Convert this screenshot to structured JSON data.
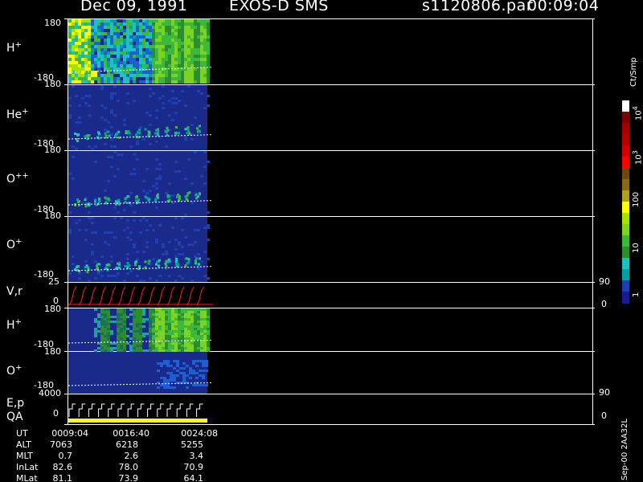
{
  "header": {
    "date": "Dec 09, 1991",
    "instrument": "EXOS-D SMS",
    "file": "s1120806.par",
    "time": "00:09:04"
  },
  "colorbar": {
    "unit": "Ct/Smp",
    "tick_labels": [
      "10",
      "10",
      "10",
      "100",
      "10",
      "1"
    ],
    "exponents": [
      "4",
      "3"
    ]
  },
  "side_note": "Sep-00 2AA32L",
  "chart_data": {
    "type": "heatmap",
    "panels": [
      {
        "name": "H+",
        "ylim": [
          -180,
          180
        ],
        "ytick_top": "180",
        "ytick_bottom": "-180"
      },
      {
        "name": "He+",
        "ylim": [
          -180,
          180
        ],
        "ytick_top": "180",
        "ytick_bottom": "-180"
      },
      {
        "name": "O++",
        "ylim": [
          -180,
          180
        ],
        "ytick_top": "180",
        "ytick_bottom": "-180"
      },
      {
        "name": "O+",
        "ylim": [
          -180,
          180
        ],
        "ytick_top": "180",
        "ytick_bottom": "-180"
      },
      {
        "name": "V,r",
        "ytick_top": "25",
        "ytick_bottom": "0",
        "rtick_top": "90",
        "rtick_bottom": "0"
      },
      {
        "name": "H+",
        "ylim": [
          -180,
          180
        ],
        "ytick_top": "180",
        "ytick_bottom": "-180"
      },
      {
        "name": "O+",
        "ylim": [
          -180,
          180
        ],
        "ytick_top": "180",
        "ytick_bottom": "-180"
      },
      {
        "name": "E,p",
        "name2": "QA",
        "ytick_top": "4000",
        "ytick_bottom": "0",
        "rtick_top": "90",
        "rtick_bottom": "0"
      }
    ],
    "x_labels": {
      "UT": [
        "0009:04",
        "0016:40",
        "0024:08"
      ],
      "ALT": [
        "7063",
        "6218",
        "5255"
      ],
      "MLT": [
        "0.7",
        "2.6",
        "3.4"
      ],
      "InLat": [
        "82.6",
        "78.0",
        "70.9"
      ],
      "MLat": [
        "81.1",
        "73.9",
        "64.1"
      ]
    },
    "row_labels": [
      "UT",
      "ALT",
      "MLT",
      "InLat",
      "MLat"
    ],
    "palette": [
      "#2a1bd0",
      "#1e3fb0",
      "#00a0a0",
      "#20c0c0",
      "#2d8c2d",
      "#3cb83c",
      "#7ed321",
      "#a8e000",
      "#ffff00",
      "#b0a020",
      "#8a6a10",
      "#ff0000",
      "#b00000",
      "#800000",
      "#ffffff"
    ]
  }
}
